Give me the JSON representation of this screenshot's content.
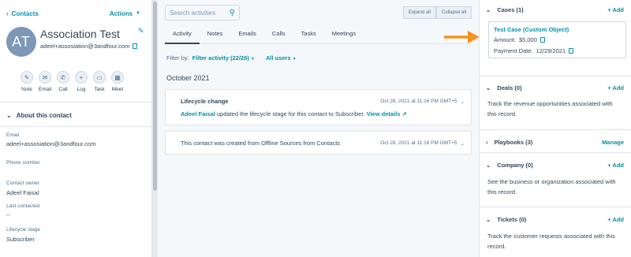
{
  "left": {
    "back_label": "Contacts",
    "actions_label": "Actions",
    "avatar_initials": "AT",
    "name": "Association Test",
    "email": "adeel+assosiation@3andfour.com",
    "quick_actions": [
      {
        "label": "Note",
        "icon": "note-icon"
      },
      {
        "label": "Email",
        "icon": "email-icon"
      },
      {
        "label": "Call",
        "icon": "call-icon"
      },
      {
        "label": "Log",
        "icon": "log-icon"
      },
      {
        "label": "Task",
        "icon": "task-icon"
      },
      {
        "label": "Meet",
        "icon": "meet-icon"
      }
    ],
    "about_title": "About this contact",
    "fields": {
      "email_label": "Email",
      "email_value": "adeel+assosiation@3andfour.com",
      "phone_label": "Phone number",
      "owner_label": "Contact owner",
      "owner_value": "Adeel Faisal",
      "last_contacted_label": "Last contacted",
      "last_contacted_value": "--",
      "lifecycle_label": "Lifecycle stage",
      "lifecycle_value": "Subscriber"
    }
  },
  "middle": {
    "search_placeholder": "Search activities",
    "expand_all": "Expand all",
    "collapse_all": "Collapse all",
    "tabs": [
      "Activity",
      "Notes",
      "Emails",
      "Calls",
      "Tasks",
      "Meetings"
    ],
    "filter_by": "Filter by:",
    "filter_activity": "Filter activity (22/26)",
    "all_users": "All users",
    "month": "October 2021",
    "lifecycle_card": {
      "title": "Lifecycle change",
      "timestamp": "Oct 28, 2021 at 11:16 PM GMT+5",
      "actor": "Adeel Faisal",
      "text": "updated the lifecycle stage for this contact to Subscriber.",
      "link": "View details"
    },
    "created_card": {
      "text": "This contact was created from Offline Sources from Contacts",
      "timestamp": "Oct 28, 2021 at 11:16 PM GMT+5"
    }
  },
  "right": {
    "cases": {
      "title": "Cases (1)",
      "add": "+ Add",
      "card_title": "Test Case (Custom Object)",
      "amount_label": "Amount:",
      "amount_value": "$5,000",
      "payment_label": "Payment Date:",
      "payment_value": "12/29/2021"
    },
    "deals": {
      "title": "Deals (0)",
      "add": "+ Add",
      "text": "Track the revenue opportunities associated with this record."
    },
    "playbooks": {
      "title": "Playbooks (3)",
      "manage": "Manage"
    },
    "company": {
      "title": "Company (0)",
      "add": "+ Add",
      "text": "See the business or organization associated with this record."
    },
    "tickets": {
      "title": "Tickets (0)",
      "add": "+ Add",
      "text": "Track the customer requests associated with this record."
    }
  },
  "colors": {
    "link": "#0091ae",
    "arrow": "#f5921b",
    "avatar": "#7c98b6"
  }
}
